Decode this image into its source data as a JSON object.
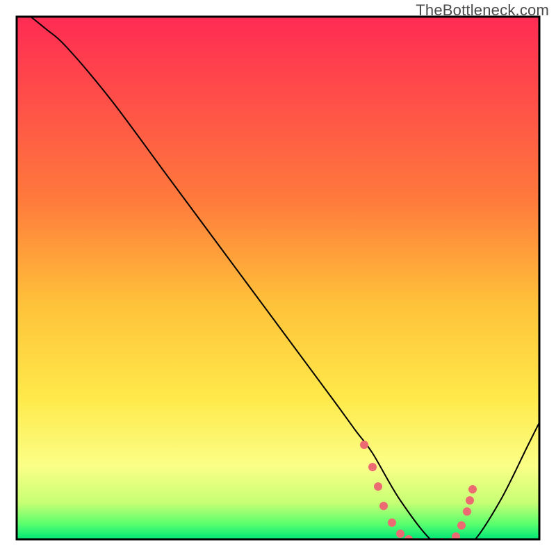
{
  "watermark": "TheBottleneck.com",
  "chart_data": {
    "type": "line",
    "title": "",
    "xlabel": "",
    "ylabel": "",
    "xlim": [
      0,
      100
    ],
    "ylim": [
      0,
      100
    ],
    "gradient_stops": [
      {
        "offset": 0,
        "color": "#ff2b53"
      },
      {
        "offset": 35,
        "color": "#ff7a3c"
      },
      {
        "offset": 55,
        "color": "#ffc23a"
      },
      {
        "offset": 73,
        "color": "#ffe94a"
      },
      {
        "offset": 86,
        "color": "#fbff87"
      },
      {
        "offset": 93,
        "color": "#c7ff74"
      },
      {
        "offset": 97,
        "color": "#5cff6e"
      },
      {
        "offset": 100,
        "color": "#00e676"
      }
    ],
    "series": [
      {
        "name": "black-curve",
        "color": "#000000",
        "width": 2.0,
        "x": [
          3.0,
          8.0,
          12.0,
          20.0,
          30.0,
          40.0,
          50.0,
          60.0,
          64.0,
          67.0,
          72.0,
          78.0,
          82.0,
          85.0,
          90.0,
          95.0,
          99.0
        ],
        "y": [
          99.0,
          95.0,
          91.5,
          82.0,
          68.5,
          55.0,
          41.5,
          28.0,
          22.5,
          18.5,
          10.0,
          2.5,
          2.5,
          2.5,
          10.0,
          20.0,
          28.0
        ]
      },
      {
        "name": "pink-dots",
        "color": "#ec6b72",
        "radius": 6,
        "x": [
          65.5,
          67.0,
          68.0,
          69.0,
          70.5,
          72.0,
          73.5,
          75.0,
          76.5,
          78.0,
          79.5,
          81.0,
          82.0,
          83.0,
          84.0,
          84.5,
          85.0
        ],
        "y": [
          20.0,
          16.0,
          12.5,
          9.0,
          6.0,
          4.0,
          3.0,
          2.5,
          2.5,
          2.5,
          2.5,
          2.5,
          3.5,
          5.5,
          8.0,
          10.0,
          12.0
        ]
      }
    ],
    "frame": {
      "x": 3,
      "y": 3,
      "w": 94,
      "h": 94
    }
  }
}
